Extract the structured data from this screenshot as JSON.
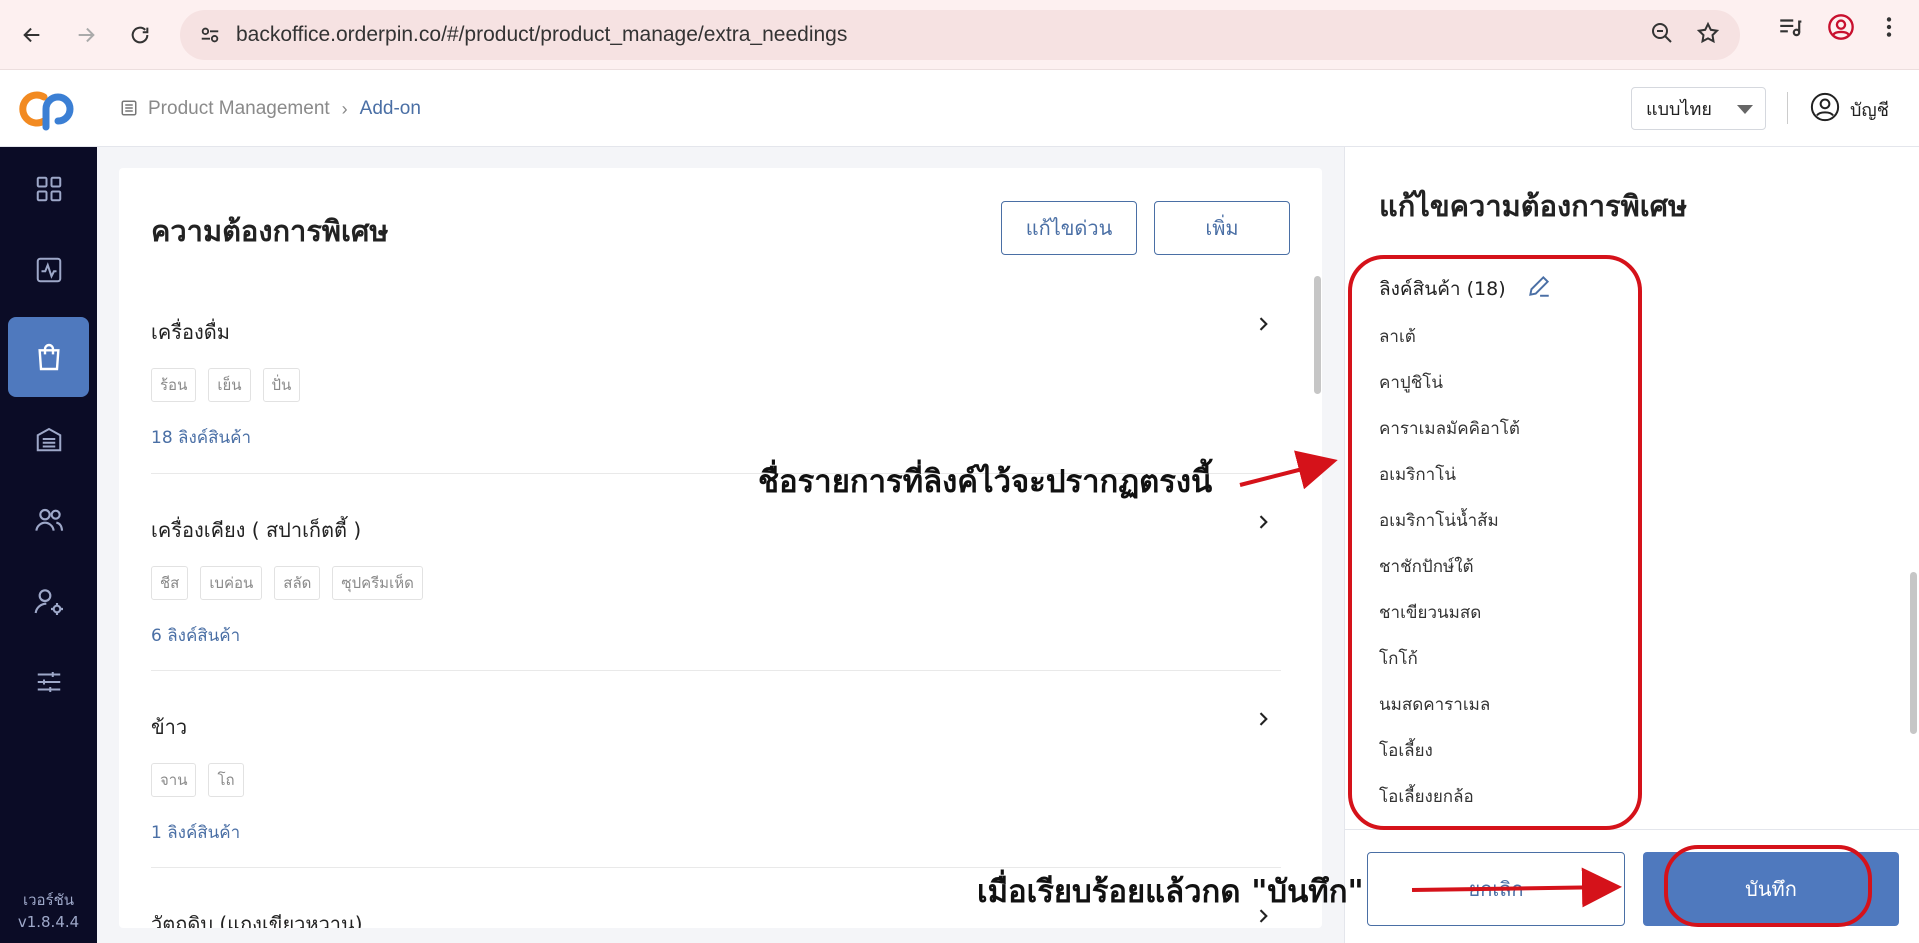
{
  "browser": {
    "url": "backoffice.orderpin.co/#/product/product_manage/extra_needings"
  },
  "header": {
    "breadcrumb": [
      "Product Management",
      "Add-on"
    ],
    "language": "แบบไทย",
    "account_label": "บัญชี"
  },
  "sidebar": {
    "items": [
      "dashboard",
      "activity",
      "products",
      "store",
      "team",
      "user-settings",
      "sliders"
    ],
    "active_index": 2,
    "version_label": "เวอร์ชัน",
    "version_number": "v1.8.4.4"
  },
  "main": {
    "title": "ความต้องการพิเศษ",
    "quick_edit_label": "แก้ไขด่วน",
    "add_label": "เพิ่ม",
    "groups": [
      {
        "name": "เครื่องดื่ม",
        "options": [
          "ร้อน",
          "เย็น",
          "ปั่น"
        ],
        "link_count": "18 ลิงค์สินค้า"
      },
      {
        "name": "เครื่องเคียง ( สปาเก็ตตี้ )",
        "options": [
          "ชีส",
          "เบค่อน",
          "สลัด",
          "ซุปครีมเห็ด"
        ],
        "link_count": "6 ลิงค์สินค้า"
      },
      {
        "name": "ข้าว",
        "options": [
          "จาน",
          "โถ"
        ],
        "link_count": "1 ลิงค์สินค้า"
      },
      {
        "name": "วัตถุดิบ (แกงเขียวหวาน)",
        "options": [],
        "link_count": ""
      }
    ]
  },
  "edit_panel": {
    "title": "แก้ไขความต้องการพิเศษ",
    "linked_header": "ลิงค์สินค้า (18)",
    "linked_products": [
      "ลาเต้",
      "คาปูชิโน่",
      "คาราเมลมัคคิอาโต้",
      "อเมริกาโน่",
      "อเมริกาโน่น้ำส้ม",
      "ชาชักปักษ์ใต้",
      "ชาเขียวนมสด",
      "โกโก้",
      "นมสดคาราเมล",
      "โอเลี้ยง",
      "โอเลี้ยงยกล้อ"
    ],
    "cancel_label": "ยกเลิก",
    "save_label": "บันทึก"
  },
  "annotations": {
    "linked_note": "ชื่อรายการที่ลิงค์ไว้จะปรากฏตรงนี้",
    "save_note": "เมื่อเรียบร้อยแล้วกด \"บันทึก\"",
    "color": "#d5121a"
  },
  "colors": {
    "accent": "#4f79be",
    "sidebar_bg": "#0b0c26",
    "link": "#4a6fa5"
  }
}
